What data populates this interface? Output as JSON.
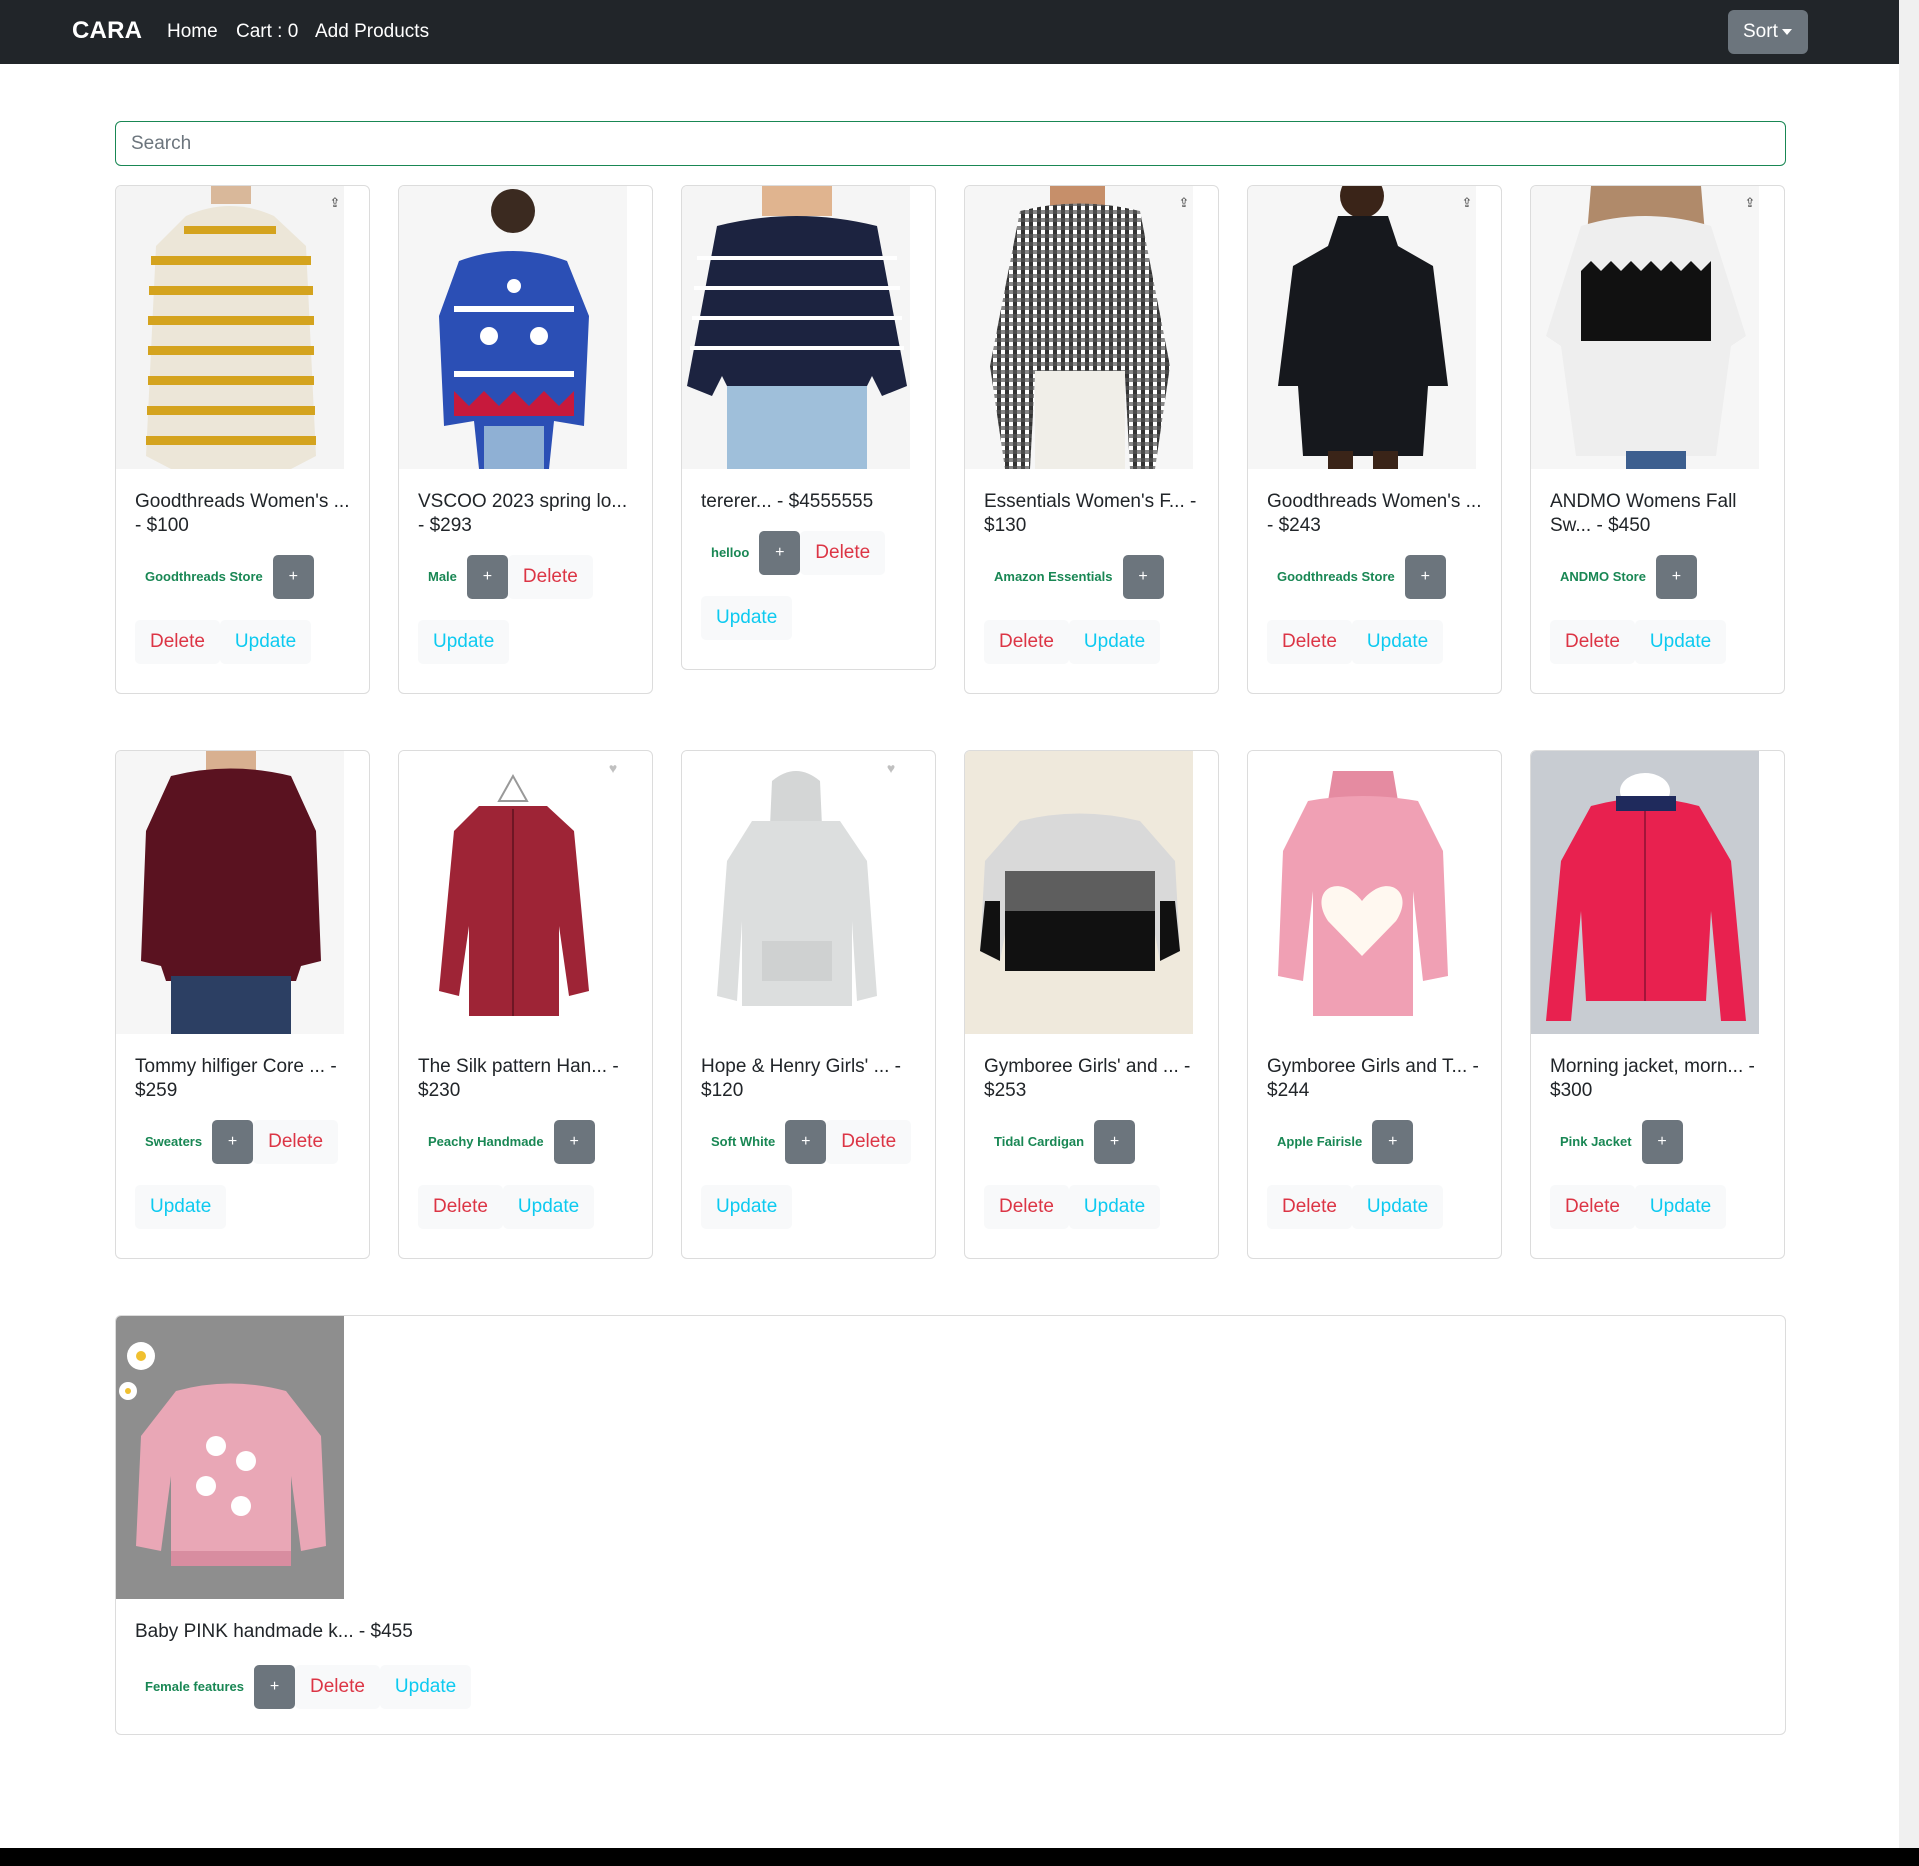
{
  "nav": {
    "brand": "CARA",
    "home": "Home",
    "cart": "Cart : 0",
    "add": "Add Products",
    "sort": "Sort"
  },
  "search": {
    "placeholder": "Search"
  },
  "colors": {
    "navbar": "#212529",
    "badge": "#198754",
    "delete": "#dc3545",
    "update": "#0dcaf0",
    "plus": "#6c757d"
  },
  "products": [
    {
      "title": "Goodthreads Women's ... - $100",
      "tag": "Goodthreads Store",
      "icon": "share-icon"
    },
    {
      "title": "VSCOO 2023 spring lo... - $293",
      "tag": "Male",
      "icon": ""
    },
    {
      "title": "tererer... - $4555555",
      "tag": "helloo",
      "icon": ""
    },
    {
      "title": "Essentials Women's F... - $130",
      "tag": "Amazon Essentials",
      "icon": "share-icon"
    },
    {
      "title": "Goodthreads Women's ... - $243",
      "tag": "Goodthreads Store",
      "icon": "share-icon"
    },
    {
      "title": "ANDMO Womens Fall Sw... - $450",
      "tag": "ANDMO Store",
      "icon": "share-icon"
    },
    {
      "title": "Tommy hilfiger Core ... - $259",
      "tag": "Sweaters",
      "icon": ""
    },
    {
      "title": "The Silk pattern Han... - $230",
      "tag": "Peachy Handmade",
      "icon": "heart-icon"
    },
    {
      "title": "Hope & Henry Girls' ... - $120",
      "tag": "Soft White",
      "icon": "heart-icon"
    },
    {
      "title": "Gymboree Girls' and ... - $253",
      "tag": "Tidal Cardigan",
      "icon": ""
    },
    {
      "title": "Gymboree Girls and T... - $244",
      "tag": "Apple Fairisle",
      "icon": ""
    },
    {
      "title": "Morning jacket, morn... - $300",
      "tag": "Pink Jacket",
      "icon": ""
    },
    {
      "title": "Baby PINK handmade k... - $455",
      "tag": "Female features",
      "icon": ""
    }
  ],
  "buttons": {
    "plus": "+",
    "delete": "Delete",
    "update": "Update"
  }
}
